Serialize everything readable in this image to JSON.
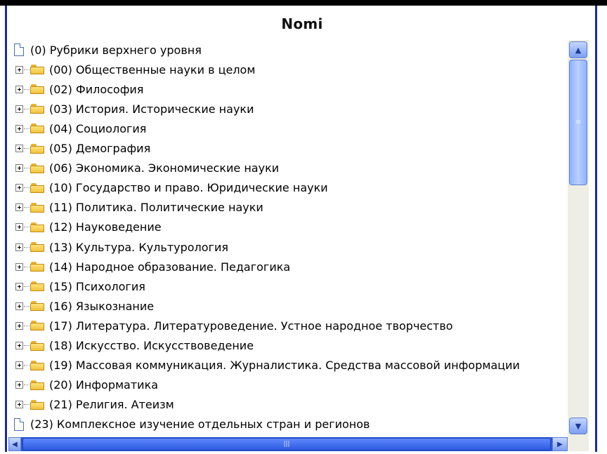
{
  "header": {
    "title": "Nomi"
  },
  "tree": {
    "items": [
      {
        "label": "(0) Рубрики верхнего уровня",
        "kind": "document",
        "expandable": false
      },
      {
        "label": "(00) Общественные науки в целом",
        "kind": "folder",
        "expandable": true
      },
      {
        "label": "(02) Философия",
        "kind": "folder",
        "expandable": true
      },
      {
        "label": "(03) История. Исторические науки",
        "kind": "folder",
        "expandable": true
      },
      {
        "label": "(04) Социология",
        "kind": "folder",
        "expandable": true
      },
      {
        "label": "(05) Демография",
        "kind": "folder",
        "expandable": true
      },
      {
        "label": "(06) Экономика. Экономические науки",
        "kind": "folder",
        "expandable": true
      },
      {
        "label": "(10) Государство и право. Юридические науки",
        "kind": "folder",
        "expandable": true
      },
      {
        "label": "(11) Политика. Политические науки",
        "kind": "folder",
        "expandable": true
      },
      {
        "label": "(12) Науковедение",
        "kind": "folder",
        "expandable": true
      },
      {
        "label": "(13) Культура. Культурология",
        "kind": "folder",
        "expandable": true
      },
      {
        "label": "(14) Народное образование. Педагогика",
        "kind": "folder",
        "expandable": true
      },
      {
        "label": "(15) Психология",
        "kind": "folder",
        "expandable": true
      },
      {
        "label": "(16) Языкознание",
        "kind": "folder",
        "expandable": true
      },
      {
        "label": "(17) Литература. Литературоведение. Устное народное творчество",
        "kind": "folder",
        "expandable": true
      },
      {
        "label": "(18) Искусство. Искусствоведение",
        "kind": "folder",
        "expandable": true
      },
      {
        "label": "(19) Массовая коммуникация. Журналистика. Средства массовой информации",
        "kind": "folder",
        "expandable": true
      },
      {
        "label": "(20) Информатика",
        "kind": "folder",
        "expandable": true
      },
      {
        "label": "(21) Религия. Атеизм",
        "kind": "folder",
        "expandable": true
      },
      {
        "label": "(23) Комплексное изучение отдельных стран и регионов",
        "kind": "document",
        "expandable": false
      }
    ]
  },
  "icons": {
    "expand": "plus-box-icon",
    "folder": "folder-icon",
    "document": "document-icon",
    "scroll_up": "chevron-up-icon",
    "scroll_down": "chevron-down-icon",
    "scroll_left": "chevron-left-icon",
    "scroll_right": "chevron-right-icon",
    "grip": "grip-lines-icon"
  },
  "colors": {
    "frame_border": "#1b2f8a",
    "scrollbar_blue": "#2b57d6",
    "folder_yellow": "#f0c341",
    "scroll_track": "#efeee4"
  }
}
